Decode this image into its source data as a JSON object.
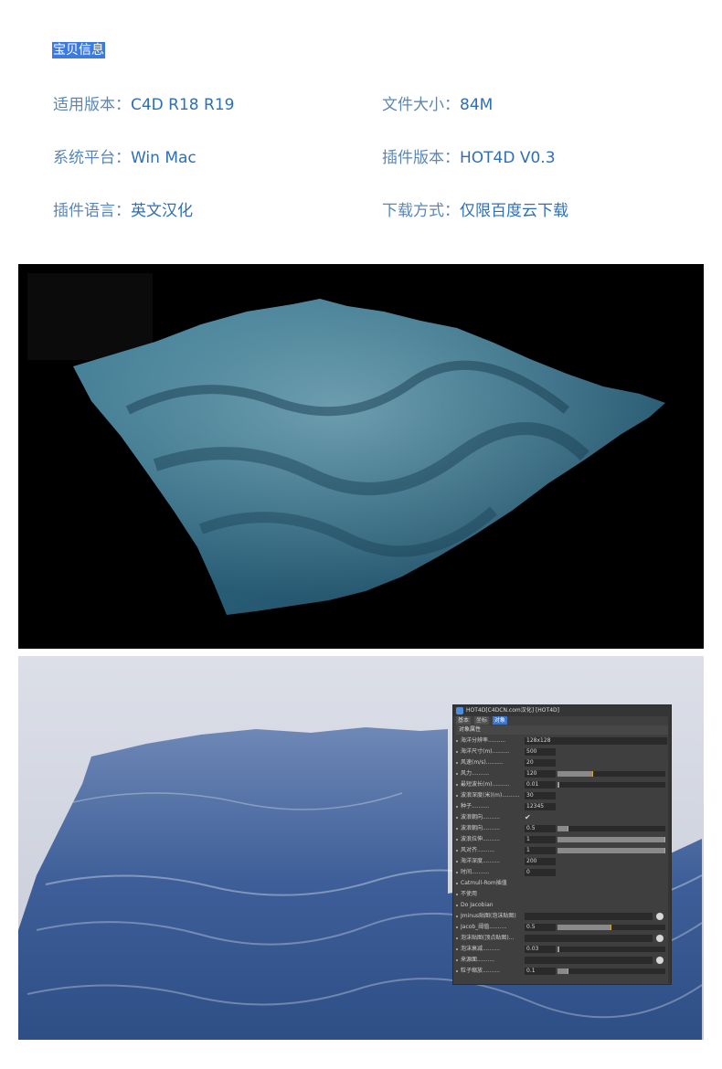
{
  "header": {
    "title": "宝贝信息"
  },
  "info": [
    {
      "left": {
        "label": "适用版本：",
        "value": "C4D R18 R19"
      },
      "right": {
        "label": "文件大小：",
        "value": "84M"
      }
    },
    {
      "left": {
        "label": "系统平台：",
        "value": "Win Mac"
      },
      "right": {
        "label": "插件版本：",
        "value": "HOT4D V0.3"
      }
    },
    {
      "left": {
        "label": "插件语言：",
        "value": "英文汉化"
      },
      "right": {
        "label": "下载方式：",
        "value": "仅限百度云下载"
      }
    }
  ],
  "dialog": {
    "title": "HOT4D[C4DCN.com汉化] [HOT4D]",
    "tabs": [
      "基本",
      "坐标",
      "对象"
    ],
    "section": "对象属性",
    "rows": [
      {
        "label": "海洋分辨率..........",
        "value": "128x128"
      },
      {
        "label": "海洋尺寸(m)..........",
        "value": "500"
      },
      {
        "label": "风速(m/s)..........",
        "value": "20"
      },
      {
        "label": "风力..........",
        "value": "120",
        "level": 0.33
      },
      {
        "label": "最短波长(m)..........",
        "value": "0.01",
        "level": 0.02
      },
      {
        "label": "波浪深度(米)(m)..........",
        "value": "30"
      },
      {
        "label": "种子..........",
        "value": "12345"
      },
      {
        "label": "波浪朝向..........",
        "value": "✔"
      },
      {
        "label": "波浪朝向..........",
        "value": "0.5",
        "level": 0.1
      },
      {
        "label": "波浪拉伸..........",
        "value": "1",
        "level": 1.0
      },
      {
        "label": "风对齐..........",
        "value": "1",
        "level": 1.0
      },
      {
        "label": "海洋深度..........",
        "value": "200"
      },
      {
        "label": "时间..........",
        "value": "0"
      },
      {
        "label": "Catmull-Rom插值"
      },
      {
        "label": "不使用"
      },
      {
        "label": "Do Jacobian"
      },
      {
        "label": "Jminus贴图(泡沫贴图)"
      },
      {
        "label": "Jacob_阈值..........",
        "value": "0.5",
        "level": 0.5
      },
      {
        "label": "泡沫贴图(顶点贴图)..."
      },
      {
        "label": "泡沫衰减..........",
        "value": "0.03",
        "level": 0.01
      },
      {
        "label": "来源面..........",
        "value": ""
      },
      {
        "label": "粒子缩放..........",
        "value": "0.1",
        "level": 0.1
      }
    ]
  }
}
